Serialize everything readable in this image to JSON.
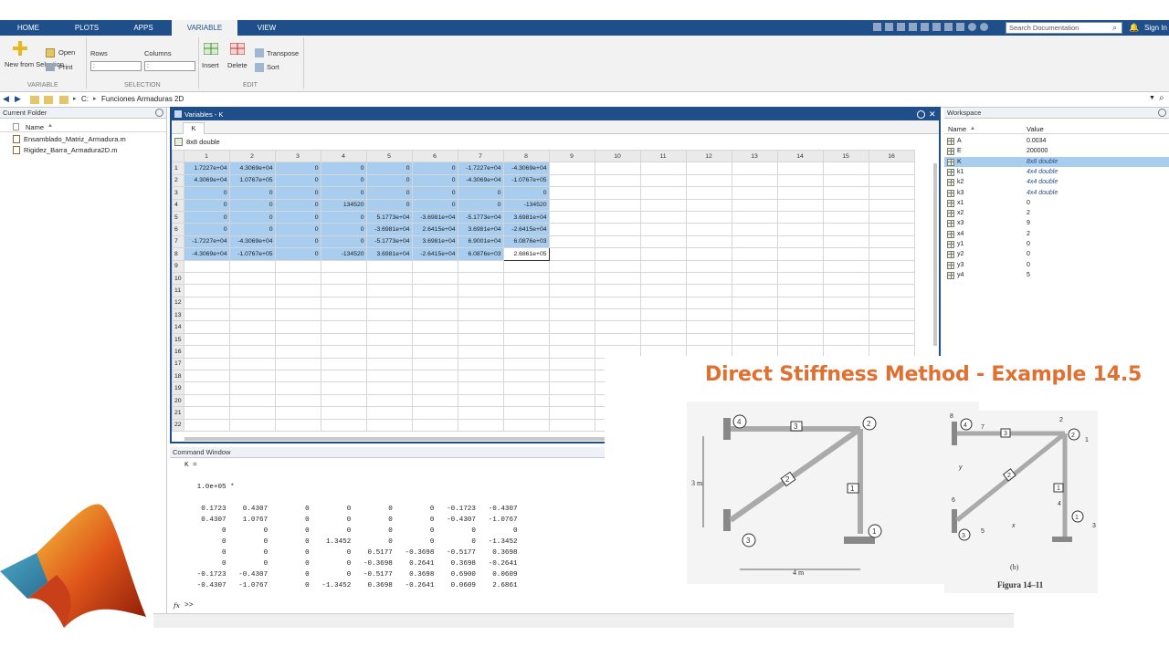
{
  "tabs": [
    "HOME",
    "PLOTS",
    "APPS",
    "VARIABLE",
    "VIEW"
  ],
  "active_tab": "VARIABLE",
  "search": {
    "placeholder": "Search Documentation"
  },
  "sign_in": "Sign In",
  "ribbon": {
    "new_from_selection": "New from Selection",
    "open": "Open",
    "print": "Print",
    "rows": "Rows",
    "columns": "Columns",
    "rows_value": ":",
    "columns_value": ":",
    "insert": "Insert",
    "delete": "Delete",
    "transpose": "Transpose",
    "sort": "Sort",
    "sections": {
      "variable": "VARIABLE",
      "selection": "SELECTION",
      "edit": "EDIT"
    }
  },
  "address": {
    "drive": "C:",
    "folder": "Funciones Armaduras 2D"
  },
  "current_folder": {
    "title": "Current Folder",
    "name_header": "Name",
    "files": [
      "Ensamblado_Matriz_Armadura.m",
      "Rigidez_Barra_Armadura2D.m"
    ]
  },
  "variables": {
    "title": "Variables - K",
    "tab": "K",
    "size": "8x8 double",
    "columns": [
      "1",
      "2",
      "3",
      "4",
      "5",
      "6",
      "7",
      "8",
      "9",
      "10",
      "11",
      "12",
      "13",
      "14",
      "15",
      "16"
    ],
    "rows": [
      [
        "1.7227e+04",
        "4.3069e+04",
        "0",
        "0",
        "0",
        "0",
        "-1.7227e+04",
        "-4.3069e+04"
      ],
      [
        "4.3069e+04",
        "1.0767e+05",
        "0",
        "0",
        "0",
        "0",
        "-4.3069e+04",
        "-1.0767e+05"
      ],
      [
        "0",
        "0",
        "0",
        "0",
        "0",
        "0",
        "0",
        "0"
      ],
      [
        "0",
        "0",
        "0",
        "134520",
        "0",
        "0",
        "0",
        "-134520"
      ],
      [
        "0",
        "0",
        "0",
        "0",
        "5.1773e+04",
        "-3.6981e+04",
        "-5.1773e+04",
        "3.6981e+04"
      ],
      [
        "0",
        "0",
        "0",
        "0",
        "-3.6981e+04",
        "2.6415e+04",
        "3.6981e+04",
        "-2.6415e+04"
      ],
      [
        "-1.7227e+04",
        "-4.3069e+04",
        "0",
        "0",
        "-5.1773e+04",
        "3.6981e+04",
        "6.9001e+04",
        "6.0876e+03"
      ],
      [
        "-4.3069e+04",
        "-1.0767e+05",
        "0",
        "-134520",
        "3.6981e+04",
        "-2.6415e+04",
        "6.0876e+03",
        "2.6861e+05"
      ]
    ],
    "row_count": 22
  },
  "workspace": {
    "title": "Workspace",
    "name_header": "Name",
    "value_header": "Value",
    "vars": [
      {
        "name": "A",
        "value": "0.0034",
        "italic": false
      },
      {
        "name": "E",
        "value": "200000",
        "italic": false
      },
      {
        "name": "K",
        "value": "8x8 double",
        "italic": true
      },
      {
        "name": "k1",
        "value": "4x4 double",
        "italic": true
      },
      {
        "name": "k2",
        "value": "4x4 double",
        "italic": true
      },
      {
        "name": "k3",
        "value": "4x4 double",
        "italic": true
      },
      {
        "name": "x1",
        "value": "0",
        "italic": false
      },
      {
        "name": "x2",
        "value": "2",
        "italic": false
      },
      {
        "name": "x3",
        "value": "9",
        "italic": false
      },
      {
        "name": "x4",
        "value": "2",
        "italic": false
      },
      {
        "name": "y1",
        "value": "0",
        "italic": false
      },
      {
        "name": "y2",
        "value": "0",
        "italic": false
      },
      {
        "name": "y3",
        "value": "0",
        "italic": false
      },
      {
        "name": "y4",
        "value": "5",
        "italic": false
      }
    ]
  },
  "command_window": {
    "title": "Command Window",
    "output": "K =\n\n   1.0e+05 *\n\n    0.1723    0.4307         0         0         0         0   -0.1723   -0.4307\n    0.4307    1.0767         0         0         0         0   -0.4307   -1.0767\n         0         0         0         0         0         0         0         0\n         0         0         0    1.3452         0         0         0   -1.3452\n         0         0         0         0    0.5177   -0.3698   -0.5177    0.3698\n         0         0         0         0   -0.3698    0.2641    0.3698   -0.2641\n   -0.1723   -0.4307         0         0   -0.5177    0.3698    0.6900    0.0609\n   -0.4307   -1.0767         0   -1.3452    0.3698   -0.2641    0.0609    2.6861",
    "prompt": ">>",
    "fx": "fx"
  },
  "overlay": {
    "heading": "Direct Stiffness Method - Example 14.5",
    "fig_a": {
      "nodes": [
        "4",
        "2",
        "3",
        "1"
      ],
      "members": [
        "3",
        "2",
        "1"
      ],
      "dim_v": "3 m",
      "dim_h": "4 m"
    },
    "fig_b": {
      "dof": [
        "8",
        "7",
        "2",
        "1",
        "6",
        "5",
        "4",
        "3"
      ],
      "nodes": [
        "4",
        "2",
        "3",
        "1"
      ],
      "members": [
        "3",
        "2",
        "1"
      ],
      "axes": [
        "y",
        "x"
      ],
      "label": "(b)",
      "caption": "Figura 14–11"
    }
  }
}
